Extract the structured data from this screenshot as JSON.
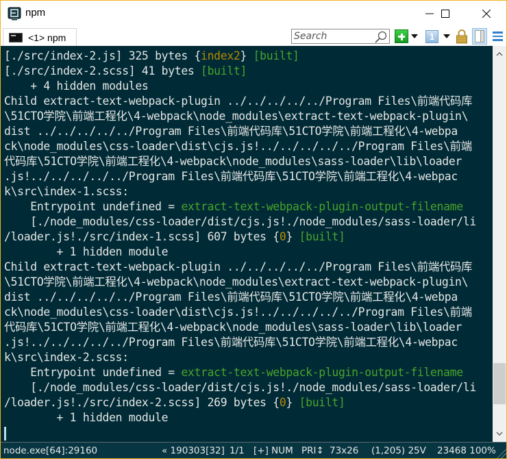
{
  "window": {
    "title": "npm",
    "accent_border_color": "#f0b41e",
    "controls": {
      "minimize": "minimize",
      "maximize": "maximize",
      "close": "close"
    }
  },
  "tabs": [
    {
      "label": "<1> npm",
      "icon": "console-icon",
      "active": true
    }
  ],
  "toolbar": {
    "search_placeholder": "Search",
    "search_value": "",
    "new_console_icon": "plus-icon",
    "tab_number_glyph": "1"
  },
  "terminal": {
    "background": "#002b36",
    "lines": [
      [
        {
          "t": "[./src/index-2.js] 325 bytes {"
        },
        {
          "t": "index2",
          "c": "y"
        },
        {
          "t": "} "
        },
        {
          "t": "[built]",
          "c": "g"
        }
      ],
      [
        {
          "t": "[./src/index-2.scss] 41 bytes "
        },
        {
          "t": "[built]",
          "c": "g"
        }
      ],
      [
        {
          "t": "    + 4 hidden modules"
        }
      ],
      [
        {
          "t": "Child extract-text-webpack-plugin ../../../../../Program Files\\前端代码库"
        }
      ],
      [
        {
          "t": "\\51CTO学院\\前端工程化\\4-webpack\\node_modules\\extract-text-webpack-plugin\\"
        }
      ],
      [
        {
          "t": "dist ../../../../../Program Files\\前端代码库\\51CTO学院\\前端工程化\\4-webpa"
        }
      ],
      [
        {
          "t": "ck\\node_modules\\css-loader\\dist\\cjs.js!../../../../../Program Files\\前端"
        }
      ],
      [
        {
          "t": "代码库\\51CTO学院\\前端工程化\\4-webpack\\node_modules\\sass-loader\\lib\\loader"
        }
      ],
      [
        {
          "t": ".js!../../../../../Program Files\\前端代码库\\51CTO学院\\前端工程化\\4-webpac"
        }
      ],
      [
        {
          "t": "k\\src\\index-1.scss:"
        }
      ],
      [
        {
          "t": "    Entrypoint undefined = "
        },
        {
          "t": "extract-text-webpack-plugin-output-filename",
          "c": "g"
        }
      ],
      [
        {
          "t": "    [./node_modules/css-loader/dist/cjs.js!./node_modules/sass-loader/li"
        }
      ],
      [
        {
          "t": "/loader.js!./src/index-1.scss] 607 bytes {"
        },
        {
          "t": "0",
          "c": "y"
        },
        {
          "t": "} "
        },
        {
          "t": "[built]",
          "c": "g"
        }
      ],
      [
        {
          "t": "        + 1 hidden module"
        }
      ],
      [
        {
          "t": "Child extract-text-webpack-plugin ../../../../../Program Files\\前端代码库"
        }
      ],
      [
        {
          "t": "\\51CTO学院\\前端工程化\\4-webpack\\node_modules\\extract-text-webpack-plugin\\"
        }
      ],
      [
        {
          "t": "dist ../../../../../Program Files\\前端代码库\\51CTO学院\\前端工程化\\4-webpa"
        }
      ],
      [
        {
          "t": "ck\\node_modules\\css-loader\\dist\\cjs.js!../../../../../Program Files\\前端"
        }
      ],
      [
        {
          "t": "代码库\\51CTO学院\\前端工程化\\4-webpack\\node_modules\\sass-loader\\lib\\loader"
        }
      ],
      [
        {
          "t": ".js!../../../../../Program Files\\前端代码库\\51CTO学院\\前端工程化\\4-webpac"
        }
      ],
      [
        {
          "t": "k\\src\\index-2.scss:"
        }
      ],
      [
        {
          "t": "    Entrypoint undefined = "
        },
        {
          "t": "extract-text-webpack-plugin-output-filename",
          "c": "g"
        }
      ],
      [
        {
          "t": "    [./node_modules/css-loader/dist/cjs.js!./node_modules/sass-loader/li"
        }
      ],
      [
        {
          "t": "/loader.js!./src/index-2.scss] 269 bytes {"
        },
        {
          "t": "0",
          "c": "y"
        },
        {
          "t": "} "
        },
        {
          "t": "[built]",
          "c": "g"
        }
      ],
      [
        {
          "t": "        + 1 hidden module"
        }
      ]
    ],
    "scroll_position_fraction": 0.93
  },
  "statusbar": {
    "process": "node.exe[64]:29160",
    "build": "« 190303[32]",
    "console_index": "1/1",
    "keys": "[+] NUM",
    "priority": "PRI↕",
    "size": "73x26",
    "cursor": "(1,205) 25V",
    "pid_zoom": "23468 100%"
  }
}
